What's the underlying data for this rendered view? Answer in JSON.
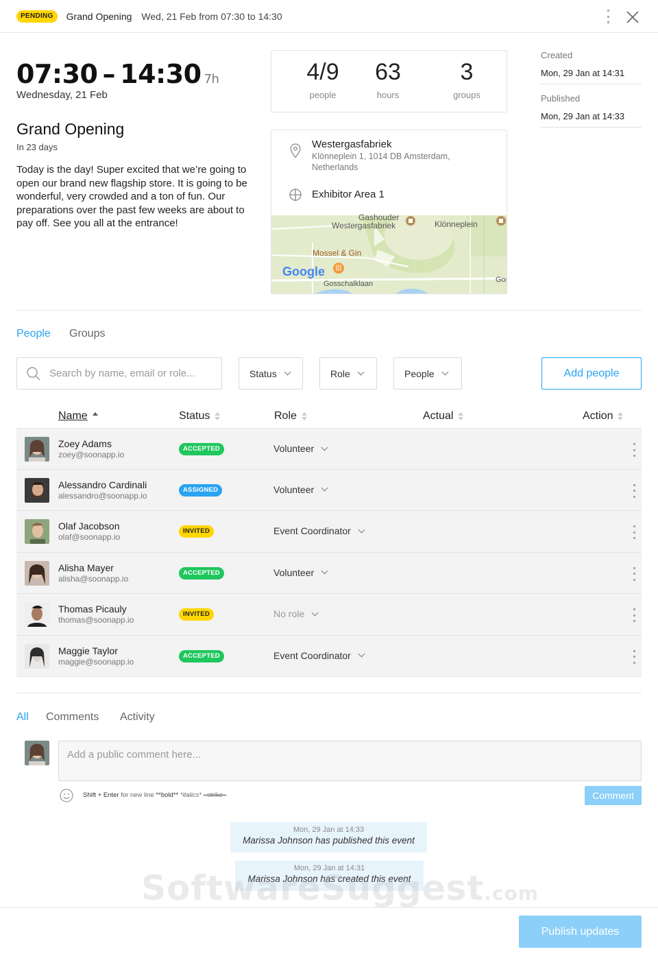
{
  "header": {
    "status_badge": "PENDING",
    "title": "Grand Opening",
    "date_text": "Wed, 21 Feb from 07:30 to 14:30"
  },
  "event": {
    "time_range": "07:30 – 14:30",
    "duration": "7h",
    "weekday": "Wednesday, 21 Feb",
    "title": "Grand Opening",
    "countdown": "In 23 days",
    "description": "Today is the day! Super excited that we’re going to open our brand new flagship store. It is going to be wonderful, very crowded and a ton of fun. Our preparations over the past few weeks are about to pay off. See you all at the entrance!"
  },
  "stats": [
    {
      "value": "4/9",
      "label": "people"
    },
    {
      "value": "63",
      "label": "hours"
    },
    {
      "value": "3",
      "label": "groups"
    }
  ],
  "location": {
    "venue": "Westergasfabriek",
    "address": "Klönneplein 1, 1014 DB Amsterdam, Netherlands",
    "area": "Exhibitor Area 1",
    "map_labels": {
      "top_cut": "Gashouder",
      "venue": "Westergasfabriek",
      "square": "Klönneplein",
      "restaurant": "Mossel & Gin",
      "street": "Gosschalklaan",
      "edge": "Gos",
      "logo": "Google"
    }
  },
  "meta": {
    "created_label": "Created",
    "created_value": "Mon, 29 Jan at 14:31",
    "published_label": "Published",
    "published_value": "Mon, 29 Jan at 14:33"
  },
  "tabs": {
    "people": "People",
    "groups": "Groups"
  },
  "filters": {
    "search_placeholder": "Search by name, email or role...",
    "status": "Status",
    "role": "Role",
    "people": "People",
    "add_button": "Add people"
  },
  "table": {
    "columns": {
      "name": "Name",
      "status": "Status",
      "role": "Role",
      "actual": "Actual",
      "action": "Action"
    },
    "rows": [
      {
        "name": "Zoey Adams",
        "email": "zoey@soonapp.io",
        "status": "ACCEPTED",
        "status_type": "accepted",
        "role": "Volunteer"
      },
      {
        "name": "Alessandro Cardinali",
        "email": "alessandro@soonapp.io",
        "status": "ASSIGNED",
        "status_type": "assigned",
        "role": "Volunteer"
      },
      {
        "name": "Olaf Jacobson",
        "email": "olaf@soonapp.io",
        "status": "INVITED",
        "status_type": "invited",
        "role": "Event Coordinator"
      },
      {
        "name": "Alisha Mayer",
        "email": "alisha@soonapp.io",
        "status": "ACCEPTED",
        "status_type": "accepted",
        "role": "Volunteer"
      },
      {
        "name": "Thomas Picauly",
        "email": "thomas@soonapp.io",
        "status": "INVITED",
        "status_type": "invited",
        "role": "No role"
      },
      {
        "name": "Maggie Taylor",
        "email": "maggie@soonapp.io",
        "status": "ACCEPTED",
        "status_type": "accepted",
        "role": "Event Coordinator"
      }
    ]
  },
  "feed_tabs": {
    "all": "All",
    "comments": "Comments",
    "activity": "Activity"
  },
  "comment": {
    "placeholder": "Add a public comment here...",
    "hint_prefix": "Shift + Enter",
    "hint_mid": " for new line  ",
    "hint_bold": "**bold**",
    "hint_italic": "*italics*",
    "hint_strike": "~strike~",
    "button": "Comment"
  },
  "activity": [
    {
      "time": "Mon, 29 Jan at 14:33",
      "text": "Marissa Johnson has published this event"
    },
    {
      "time": "Mon, 29 Jan at 14:31",
      "text": "Marissa Johnson has created this event"
    }
  ],
  "watermark": {
    "main": "SoftwareSuggest",
    "suffix": ".com"
  },
  "footer": {
    "publish_button": "Publish updates"
  },
  "colors": {
    "accent": "#2aa3f0",
    "accepted": "#1fc75d",
    "invited": "#ffd600",
    "pending": "#ffd600"
  }
}
